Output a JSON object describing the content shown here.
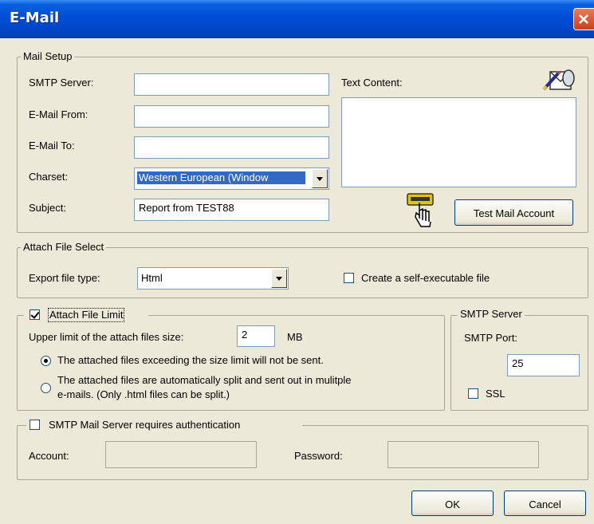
{
  "window": {
    "title": "E-Mail"
  },
  "mail_setup": {
    "group_label": "Mail Setup",
    "smtp_server_label": "SMTP Server:",
    "smtp_server_value": "",
    "email_from_label": "E-Mail From:",
    "email_from_value": "",
    "email_to_label": "E-Mail To:",
    "email_to_value": "",
    "charset_label": "Charset:",
    "charset_value": "Western European (Window",
    "subject_label": "Subject:",
    "subject_value": "Report from TEST88",
    "text_content_label": "Text Content:",
    "text_content_value": "",
    "test_button": "Test Mail Account"
  },
  "attach_select": {
    "group_label": "Attach File Select",
    "export_type_label": "Export file type:",
    "export_type_value": "Html",
    "self_exec_label": "Create a self-executable file",
    "self_exec_checked": false
  },
  "attach_limit": {
    "label": "Attach File Limit",
    "checked": true,
    "upper_limit_label": "Upper limit of the attach files size:",
    "upper_limit_value": "2",
    "unit": "MB",
    "option1": "The attached files exceeding the size limit will not be sent.",
    "option2_line1": "The attached files are automatically split and sent out in mulitple",
    "option2_line2": "e-mails. (Only .html files can be split.)",
    "selected_option": 1
  },
  "smtp_server": {
    "group_label": "SMTP Server",
    "port_label": "SMTP Port:",
    "port_value": "25",
    "ssl_label": "SSL",
    "ssl_checked": false
  },
  "auth": {
    "label": "SMTP Mail Server requires authentication",
    "checked": false,
    "account_label": "Account:",
    "account_value": "",
    "password_label": "Password:",
    "password_value": ""
  },
  "buttons": {
    "ok": "OK",
    "cancel": "Cancel"
  }
}
